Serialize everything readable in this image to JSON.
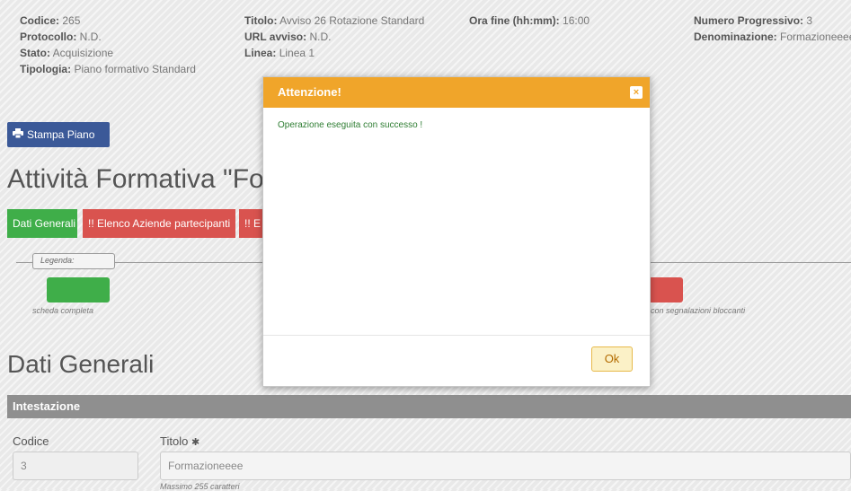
{
  "info": {
    "col1": [
      {
        "label": "Codice:",
        "value": "265"
      },
      {
        "label": "Protocollo:",
        "value": "N.D."
      },
      {
        "label": "Stato:",
        "value": "Acquisizione"
      },
      {
        "label": "Tipologia:",
        "value": "Piano formativo Standard"
      }
    ],
    "col2": [
      {
        "label": "Titolo:",
        "value": "Avviso 26 Rotazione Standard"
      },
      {
        "label": "URL avviso:",
        "value": "N.D."
      },
      {
        "label": "Linea:",
        "value": "Linea 1"
      }
    ],
    "col3": [
      {
        "label": "Ora fine (hh:mm):",
        "value": "16:00"
      }
    ],
    "col4": [
      {
        "label": "Numero Progressivo:",
        "value": "3"
      },
      {
        "label": "Denominazione:",
        "value": "Formazioneeee"
      }
    ]
  },
  "print_button": {
    "label": "Stampa Piano",
    "icon": "printer-icon"
  },
  "page_title": "Attività Formativa \"Fo",
  "tabs": [
    {
      "label": "Dati Generali",
      "status": "green"
    },
    {
      "label": "!! Elenco Aziende partecipanti",
      "status": "red"
    },
    {
      "label": "!! E",
      "status": "red"
    }
  ],
  "legend": {
    "title": "Legenda:",
    "items": [
      {
        "label": "scheda completa",
        "color": "#3fae49"
      },
      {
        "label": "con segnalazioni bloccanti",
        "color": "#d9534f"
      }
    ]
  },
  "section_title": "Dati Generali",
  "intestazione": {
    "title": "Intestazione"
  },
  "form": {
    "codice_label": "Codice",
    "codice_value": "3",
    "titolo_label": "Titolo",
    "titolo_required": "✱",
    "titolo_value": "Formazioneeee",
    "titolo_hint": "Massimo 255 caratteri"
  },
  "modal": {
    "title": "Attenzione!",
    "close": "×",
    "message": "Operazione eseguita con successo !",
    "ok_label": "Ok"
  },
  "colors": {
    "accent": "#f0a52a",
    "primary": "#3b5998",
    "success": "#3fae49",
    "danger": "#d9534f"
  }
}
